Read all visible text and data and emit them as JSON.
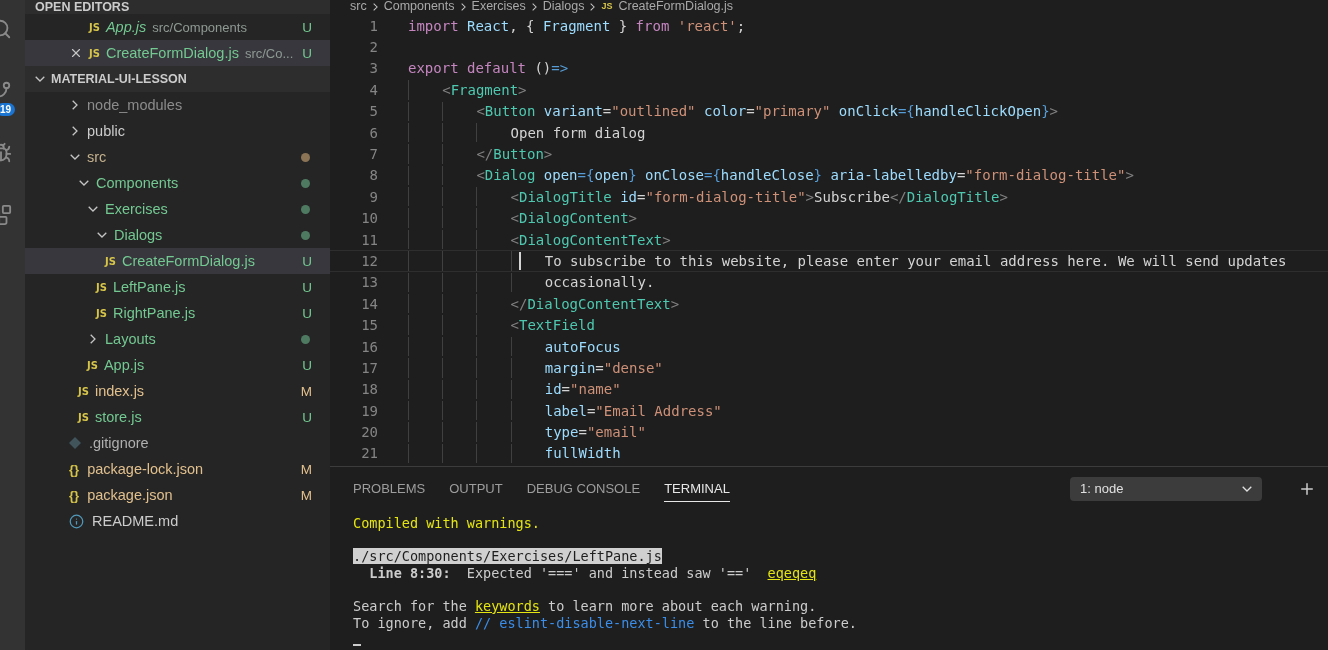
{
  "activity_bar": {
    "badge": "19"
  },
  "open_editors": {
    "title": "OPEN EDITORS",
    "items": [
      {
        "icon_text": "JS",
        "name": "App.js",
        "path": "src/Components",
        "status": "U",
        "preview": true,
        "selected": false
      },
      {
        "icon_text": "JS",
        "name": "CreateFormDialog.js",
        "path": "src/Co...",
        "status": "U",
        "preview": false,
        "selected": true
      }
    ]
  },
  "explorer": {
    "title": "MATERIAL-UI-LESSON",
    "expanded": true,
    "tree": [
      {
        "kind": "folder",
        "name": "node_modules",
        "expanded": false,
        "color": "#8c8c8c",
        "selected": false
      },
      {
        "kind": "folder",
        "name": "public",
        "expanded": false,
        "color": "#cccccc",
        "selected": false
      },
      {
        "kind": "folder",
        "name": "src",
        "expanded": true,
        "color": "#c4b08c",
        "dot": {
          "color": "#8b7355"
        },
        "selected": false,
        "children": [
          {
            "kind": "folder",
            "name": "Components",
            "expanded": true,
            "color": "#73c991",
            "dot": {
              "color": "#4f7a62"
            },
            "selected": false,
            "children": [
              {
                "kind": "folder",
                "name": "Exercises",
                "expanded": true,
                "color": "#73c991",
                "dot": {
                  "color": "#4f7a62"
                },
                "selected": false,
                "children": [
                  {
                    "kind": "folder",
                    "name": "Dialogs",
                    "expanded": true,
                    "color": "#73c991",
                    "dot": {
                      "color": "#4f7a62"
                    },
                    "selected": false,
                    "children": [
                      {
                        "kind": "js",
                        "icon_text": "JS",
                        "name": "CreateFormDialog.js",
                        "status": "U",
                        "color": "#73c991",
                        "selected": true
                      }
                    ]
                  },
                  {
                    "kind": "js",
                    "icon_text": "JS",
                    "name": "LeftPane.js",
                    "status": "U",
                    "color": "#73c991",
                    "selected": false
                  },
                  {
                    "kind": "js",
                    "icon_text": "JS",
                    "name": "RightPane.js",
                    "status": "U",
                    "color": "#73c991",
                    "selected": false
                  }
                ]
              },
              {
                "kind": "folder",
                "name": "Layouts",
                "expanded": false,
                "color": "#73c991",
                "dot": {
                  "color": "#4f7a62"
                },
                "selected": false
              },
              {
                "kind": "js",
                "icon_text": "JS",
                "name": "App.js",
                "status": "U",
                "color": "#73c991",
                "selected": false
              }
            ]
          },
          {
            "kind": "js",
            "icon_text": "JS",
            "name": "index.js",
            "status": "M",
            "color": "#e2c08d",
            "selected": false
          },
          {
            "kind": "js",
            "icon_text": "JS",
            "name": "store.js",
            "status": "U",
            "color": "#73c991",
            "selected": false
          }
        ]
      },
      {
        "kind": "git",
        "name": ".gitignore",
        "color": "#b0b0b0",
        "selected": false
      },
      {
        "kind": "json",
        "icon_text": "{}",
        "name": "package-lock.json",
        "status": "M",
        "color": "#e2c08d",
        "selected": false
      },
      {
        "kind": "json",
        "icon_text": "{}",
        "name": "package.json",
        "status": "M",
        "color": "#e2c08d",
        "selected": false
      },
      {
        "kind": "info",
        "name": "README.md",
        "color": "#cccccc",
        "selected": false
      }
    ]
  },
  "breadcrumb": {
    "parts": [
      "src",
      "Components",
      "Exercises",
      "Dialogs"
    ],
    "file_icon": "JS",
    "file": "CreateFormDialog.js"
  },
  "editor": {
    "lines": [
      {
        "n": "1",
        "current": false,
        "tokens": [
          {
            "text": "import",
            "kind": "kw"
          },
          {
            "text": " React",
            "kind": "var"
          },
          {
            "text": ", { ",
            "kind": "plain"
          },
          {
            "text": "Fragment",
            "kind": "var"
          },
          {
            "text": " } ",
            "kind": "plain"
          },
          {
            "text": "from",
            "kind": "kw"
          },
          {
            "text": " 'react'",
            "kind": "str"
          },
          {
            "text": ";",
            "kind": "plain"
          }
        ]
      },
      {
        "n": "2",
        "current": false
      },
      {
        "n": "3",
        "current": false,
        "tokens": [
          {
            "text": "export default",
            "kind": "kw"
          },
          {
            "text": " ()",
            "kind": "plain"
          },
          {
            "text": "=>",
            "kind": "op"
          }
        ],
        "children": [
          {
            "n": "4",
            "current": false,
            "tokens": [
              {
                "text": "<",
                "kind": "punct"
              },
              {
                "text": "Fragment",
                "kind": "tag"
              },
              {
                "text": ">",
                "kind": "punct"
              }
            ],
            "children": [
              {
                "n": "5",
                "current": false,
                "tokens": [
                  {
                    "text": "<",
                    "kind": "punct"
                  },
                  {
                    "text": "Button",
                    "kind": "tag"
                  },
                  {
                    "text": " variant",
                    "kind": "var"
                  },
                  {
                    "text": "=",
                    "kind": "plain"
                  },
                  {
                    "text": "\"outlined\"",
                    "kind": "str"
                  },
                  {
                    "text": " color",
                    "kind": "var"
                  },
                  {
                    "text": "=",
                    "kind": "plain"
                  },
                  {
                    "text": "\"primary\"",
                    "kind": "str"
                  },
                  {
                    "text": " onClick",
                    "kind": "var"
                  },
                  {
                    "text": "={",
                    "kind": "op"
                  },
                  {
                    "text": "handleClickOpen",
                    "kind": "var"
                  },
                  {
                    "text": "}",
                    "kind": "op"
                  },
                  {
                    "text": ">",
                    "kind": "punct"
                  }
                ],
                "children": [
                  {
                    "n": "6",
                    "current": false,
                    "tokens": [
                      {
                        "text": "Open form dialog",
                        "kind": "plain"
                      }
                    ]
                  }
                ]
              },
              {
                "n": "7",
                "current": false,
                "tokens": [
                  {
                    "text": "</",
                    "kind": "punct"
                  },
                  {
                    "text": "Button",
                    "kind": "tag"
                  },
                  {
                    "text": ">",
                    "kind": "punct"
                  }
                ]
              },
              {
                "n": "8",
                "current": false,
                "tokens": [
                  {
                    "text": "<",
                    "kind": "punct"
                  },
                  {
                    "text": "Dialog",
                    "kind": "tag"
                  },
                  {
                    "text": " open",
                    "kind": "var"
                  },
                  {
                    "text": "={",
                    "kind": "op"
                  },
                  {
                    "text": "open",
                    "kind": "var"
                  },
                  {
                    "text": "}",
                    "kind": "op"
                  },
                  {
                    "text": " onClose",
                    "kind": "var"
                  },
                  {
                    "text": "={",
                    "kind": "op"
                  },
                  {
                    "text": "handleClose",
                    "kind": "var"
                  },
                  {
                    "text": "}",
                    "kind": "op"
                  },
                  {
                    "text": " aria-labelledby",
                    "kind": "var"
                  },
                  {
                    "text": "=",
                    "kind": "plain"
                  },
                  {
                    "text": "\"form-dialog-title\"",
                    "kind": "str"
                  },
                  {
                    "text": ">",
                    "kind": "punct"
                  }
                ],
                "children": [
                  {
                    "n": "9",
                    "current": false,
                    "tokens": [
                      {
                        "text": "<",
                        "kind": "punct"
                      },
                      {
                        "text": "DialogTitle",
                        "kind": "tag"
                      },
                      {
                        "text": " id",
                        "kind": "var"
                      },
                      {
                        "text": "=",
                        "kind": "plain"
                      },
                      {
                        "text": "\"form-dialog-title\"",
                        "kind": "str"
                      },
                      {
                        "text": ">",
                        "kind": "punct"
                      },
                      {
                        "text": "Subscribe",
                        "kind": "plain"
                      },
                      {
                        "text": "</",
                        "kind": "punct"
                      },
                      {
                        "text": "DialogTitle",
                        "kind": "tag"
                      },
                      {
                        "text": ">",
                        "kind": "punct"
                      }
                    ]
                  },
                  {
                    "n": "10",
                    "current": false,
                    "tokens": [
                      {
                        "text": "<",
                        "kind": "punct"
                      },
                      {
                        "text": "DialogContent",
                        "kind": "tag"
                      },
                      {
                        "text": ">",
                        "kind": "punct"
                      }
                    ]
                  },
                  {
                    "n": "11",
                    "current": false,
                    "tokens": [
                      {
                        "text": "<",
                        "kind": "punct"
                      },
                      {
                        "text": "DialogContentText",
                        "kind": "tag"
                      },
                      {
                        "text": ">",
                        "kind": "punct"
                      }
                    ],
                    "children": [
                      {
                        "n": "12",
                        "current": true,
                        "tokens": [
                          {
                            "text": "To subscribe to this website, please enter your email address here. We will send updates",
                            "kind": "plain"
                          }
                        ]
                      },
                      {
                        "n": "13",
                        "current": false,
                        "tokens": [
                          {
                            "text": "occasionally.",
                            "kind": "plain"
                          }
                        ]
                      }
                    ]
                  },
                  {
                    "n": "14",
                    "current": false,
                    "tokens": [
                      {
                        "text": "</",
                        "kind": "punct"
                      },
                      {
                        "text": "DialogContentText",
                        "kind": "tag"
                      },
                      {
                        "text": ">",
                        "kind": "punct"
                      }
                    ]
                  },
                  {
                    "n": "15",
                    "current": false,
                    "tokens": [
                      {
                        "text": "<",
                        "kind": "punct"
                      },
                      {
                        "text": "TextField",
                        "kind": "tag"
                      }
                    ],
                    "children": [
                      {
                        "n": "16",
                        "current": false,
                        "tokens": [
                          {
                            "text": "autoFocus",
                            "kind": "var"
                          }
                        ]
                      },
                      {
                        "n": "17",
                        "current": false,
                        "tokens": [
                          {
                            "text": "margin",
                            "kind": "var"
                          },
                          {
                            "text": "=",
                            "kind": "plain"
                          },
                          {
                            "text": "\"dense\"",
                            "kind": "str"
                          }
                        ]
                      },
                      {
                        "n": "18",
                        "current": false,
                        "tokens": [
                          {
                            "text": "id",
                            "kind": "var"
                          },
                          {
                            "text": "=",
                            "kind": "plain"
                          },
                          {
                            "text": "\"name\"",
                            "kind": "str"
                          }
                        ]
                      },
                      {
                        "n": "19",
                        "current": false,
                        "tokens": [
                          {
                            "text": "label",
                            "kind": "var"
                          },
                          {
                            "text": "=",
                            "kind": "plain"
                          },
                          {
                            "text": "\"Email Address\"",
                            "kind": "str"
                          }
                        ]
                      },
                      {
                        "n": "20",
                        "current": false,
                        "tokens": [
                          {
                            "text": "type",
                            "kind": "var"
                          },
                          {
                            "text": "=",
                            "kind": "plain"
                          },
                          {
                            "text": "\"email\"",
                            "kind": "str"
                          }
                        ]
                      },
                      {
                        "n": "21",
                        "current": false,
                        "tokens": [
                          {
                            "text": "fullWidth",
                            "kind": "var"
                          }
                        ]
                      }
                    ]
                  }
                ]
              }
            ]
          }
        ]
      }
    ]
  },
  "panel": {
    "tabs": [
      {
        "label": "PROBLEMS",
        "selected": false
      },
      {
        "label": "OUTPUT",
        "selected": false
      },
      {
        "label": "DEBUG CONSOLE",
        "selected": false
      },
      {
        "label": "TERMINAL",
        "selected": true
      }
    ],
    "terminal_select": {
      "value": "1: node"
    },
    "terminal": [
      {
        "lines": [
          {
            "spans": [
              {
                "text": "Compiled with warnings.",
                "kind": "warn"
              }
            ]
          }
        ]
      },
      {
        "lines": [
          {
            "spans": [
              {
                "text": "./src/Components/Exercises/LeftPane.js",
                "kind": "sel"
              }
            ]
          },
          {
            "spans": [
              {
                "text": "  Line 8:30:",
                "kind": "bold"
              },
              {
                "text": "  Expected '===' and instead saw '=='  ",
                "kind": "plain"
              },
              {
                "text": "eqeqeq",
                "kind": "link"
              }
            ]
          }
        ]
      },
      {
        "lines": [
          {
            "spans": [
              {
                "text": "Search for the ",
                "kind": "plain"
              },
              {
                "text": "keywords",
                "kind": "link"
              },
              {
                "text": " to learn more about each warning.",
                "kind": "plain"
              }
            ]
          },
          {
            "spans": [
              {
                "text": "To ignore, add ",
                "kind": "plain"
              },
              {
                "text": "// eslint-disable-next-line",
                "kind": "comment"
              },
              {
                "text": " to the line before.",
                "kind": "plain"
              }
            ]
          }
        ]
      }
    ]
  }
}
